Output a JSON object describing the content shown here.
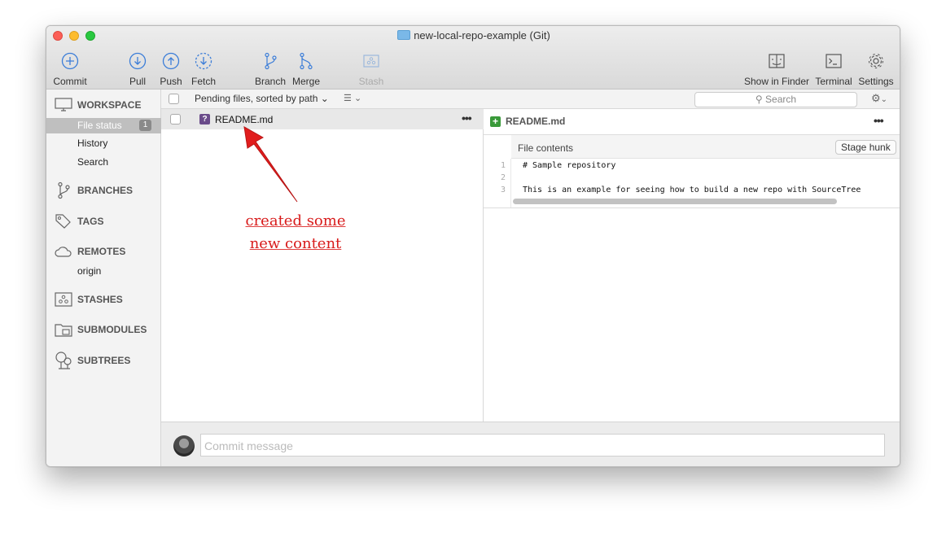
{
  "window": {
    "title": "new-local-repo-example (Git)"
  },
  "toolbar": {
    "commit": "Commit",
    "pull": "Pull",
    "push": "Push",
    "fetch": "Fetch",
    "branch": "Branch",
    "merge": "Merge",
    "stash": "Stash",
    "show_in_finder": "Show in Finder",
    "terminal": "Terminal",
    "settings": "Settings"
  },
  "sidebar": {
    "workspace": "WORKSPACE",
    "file_status": "File status",
    "file_status_count": "1",
    "history": "History",
    "search": "Search",
    "branches": "BRANCHES",
    "tags": "TAGS",
    "remotes": "REMOTES",
    "origin": "origin",
    "stashes": "STASHES",
    "submodules": "SUBMODULES",
    "subtrees": "SUBTREES"
  },
  "filebar": {
    "sort_label": "Pending files, sorted by path",
    "search_placeholder": "Search"
  },
  "files": [
    {
      "status": "?",
      "name": "README.md"
    }
  ],
  "diff": {
    "file_name": "README.md",
    "hunk_title": "File contents",
    "stage_hunk": "Stage hunk",
    "lines": [
      {
        "num": "1",
        "text": "# Sample repository"
      },
      {
        "num": "2",
        "text": ""
      },
      {
        "num": "3",
        "text": "This is an example for seeing how to build a new repo with SourceTree"
      }
    ]
  },
  "commit": {
    "placeholder": "Commit message"
  },
  "annotation": {
    "line1": "created some",
    "line2": "new content"
  },
  "colors": {
    "annotation": "#d81b1b",
    "accent": "#3b7dd8",
    "added": "#3a9a3a",
    "untracked": "#6a4b8a"
  }
}
